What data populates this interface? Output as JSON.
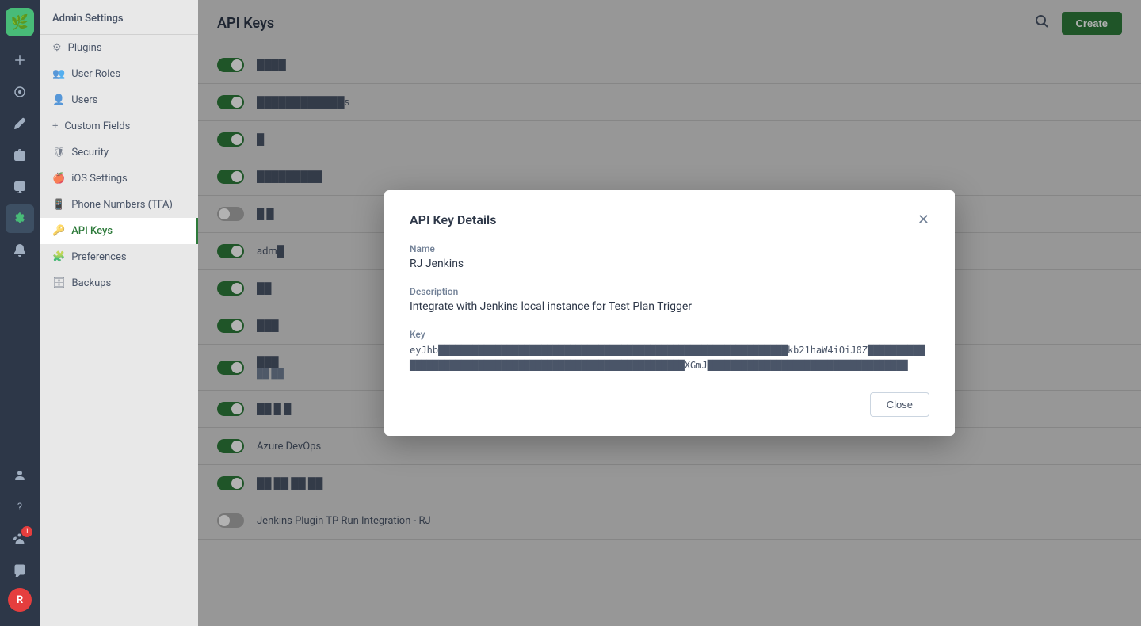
{
  "app": {
    "title": "Admin Settings"
  },
  "icon_nav": {
    "logo": "🌿",
    "icons": [
      {
        "name": "add",
        "symbol": "+",
        "active": false
      },
      {
        "name": "dashboard",
        "symbol": "◉",
        "active": false
      },
      {
        "name": "edit",
        "symbol": "✏",
        "active": false
      },
      {
        "name": "briefcase",
        "symbol": "💼",
        "active": false
      },
      {
        "name": "monitor",
        "symbol": "🖥",
        "active": false
      },
      {
        "name": "settings",
        "symbol": "⚙",
        "active": true
      },
      {
        "name": "bell",
        "symbol": "🔔",
        "active": false
      }
    ],
    "bottom_icons": [
      {
        "name": "person",
        "symbol": "👤"
      },
      {
        "name": "help",
        "symbol": "?"
      },
      {
        "name": "team-badge",
        "symbol": "👥",
        "badge": "1"
      },
      {
        "name": "chat",
        "symbol": "💬"
      }
    ],
    "avatar": "R"
  },
  "sidebar": {
    "header": "Admin Settings",
    "items": [
      {
        "label": "Plugins",
        "icon": "🔌",
        "active": false
      },
      {
        "label": "User Roles",
        "icon": "👥",
        "active": false
      },
      {
        "label": "Users",
        "icon": "👤",
        "active": false
      },
      {
        "label": "Custom Fields",
        "icon": "+",
        "active": false
      },
      {
        "label": "Security",
        "icon": "🛡",
        "active": false
      },
      {
        "label": "iOS Settings",
        "icon": "🍎",
        "active": false
      },
      {
        "label": "Phone Numbers (TFA)",
        "icon": "📱",
        "active": false
      },
      {
        "label": "API Keys",
        "icon": "🔑",
        "active": true
      },
      {
        "label": "Preferences",
        "icon": "🧩",
        "active": false
      },
      {
        "label": "Backups",
        "icon": "🗄",
        "active": false
      }
    ]
  },
  "main": {
    "title": "API Keys",
    "create_label": "Create"
  },
  "api_keys": [
    {
      "id": 1,
      "name": "████",
      "sub": "",
      "enabled": true
    },
    {
      "id": 2,
      "name": "████████████s",
      "sub": "",
      "enabled": true
    },
    {
      "id": 3,
      "name": "█",
      "sub": "",
      "enabled": true
    },
    {
      "id": 4,
      "name": "█████████",
      "sub": "",
      "enabled": true
    },
    {
      "id": 5,
      "name": "█ █",
      "sub": "",
      "enabled": false
    },
    {
      "id": 6,
      "name": "adm█",
      "sub": "",
      "enabled": true
    },
    {
      "id": 7,
      "name": "██",
      "sub": "",
      "enabled": true
    },
    {
      "id": 8,
      "name": "███",
      "sub": "",
      "enabled": true
    },
    {
      "id": 9,
      "name": "███",
      "sub": "██ ██",
      "enabled": true
    },
    {
      "id": 10,
      "name": "██ █ █",
      "sub": "",
      "enabled": true
    },
    {
      "id": 11,
      "name": "Azure DevOps",
      "sub": "",
      "enabled": true
    },
    {
      "id": 12,
      "name": "██ ██ ██ ██",
      "sub": "",
      "enabled": true
    },
    {
      "id": 13,
      "name": "Jenkins Plugin TP Run Integration - RJ",
      "sub": "",
      "enabled": false
    }
  ],
  "modal": {
    "title": "API Key Details",
    "name_label": "Name",
    "name_value": "RJ Jenkins",
    "description_label": "Description",
    "description_value": "Integrate with Jenkins local instance for Test Plan Trigger",
    "key_label": "Key",
    "key_value": "eyJhb█████████████████████████████████████████████████████████████kb21haW4iOiJ0Z██████████████████████████████████████████████████████████XGmJ███████████████████████████████████",
    "close_label": "Close"
  }
}
